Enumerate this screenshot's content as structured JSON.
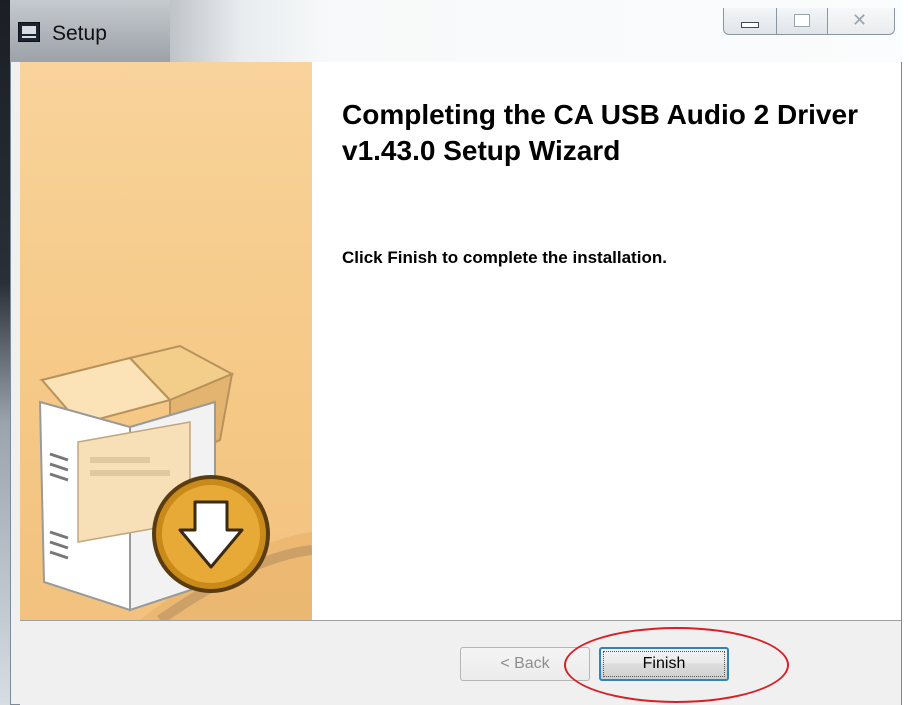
{
  "window": {
    "title": "Setup",
    "controls": {
      "minimize_icon": "minimize-icon",
      "maximize_icon": "maximize-icon",
      "close_icon": "close-icon"
    }
  },
  "wizard": {
    "heading": "Completing the CA USB Audio 2 Driver v1.43.0 Setup Wizard",
    "message": "Click Finish to complete the installation.",
    "banner_image": "installer-box-icon",
    "banner_color": "#f6ca89"
  },
  "buttons": {
    "back_label": "< Back",
    "finish_label": "Finish"
  },
  "annotation": {
    "highlight_color": "#d81f26"
  }
}
